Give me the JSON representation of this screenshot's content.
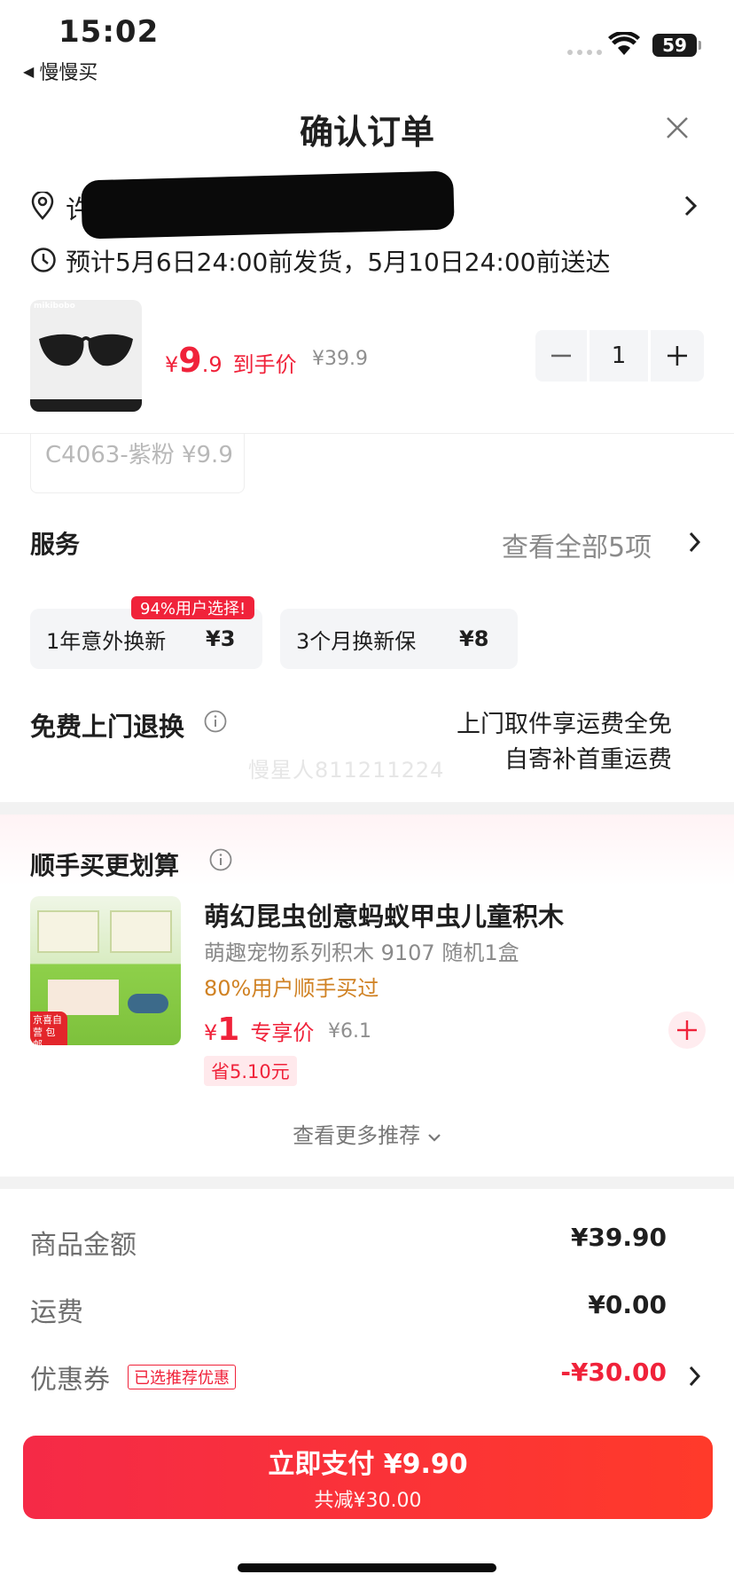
{
  "status_bar": {
    "time": "15:02",
    "back_app": "慢慢买",
    "battery": "59"
  },
  "header": {
    "title": "确认订单"
  },
  "address": {
    "visible_prefix": "许",
    "delivery": "预计5月6日24:00前发货，5月10日24:00前送达"
  },
  "product": {
    "brand": "mikibobo",
    "price_yen": "¥",
    "price_int": "9",
    "price_dec": ".9",
    "price_label": "到手价",
    "original_price": "¥39.9",
    "quantity": "1",
    "variant": "C4063-紫粉 ¥9.9"
  },
  "services": {
    "title": "服务",
    "view_all": "查看全部5项",
    "options": [
      {
        "name": "1年意外换新",
        "price": "¥3",
        "badge": "94%用户选择!"
      },
      {
        "name": "3个月换新保",
        "price": "¥8"
      }
    ],
    "return_title": "免费上门退换",
    "return_line1": "上门取件享运费全免",
    "return_line2": "自寄补首重运费",
    "watermark": "慢星人811211224"
  },
  "recommend": {
    "title": "顺手买更划算",
    "name": "萌幻昆虫创意蚂蚁甲虫儿童积木",
    "sub": "萌趣宠物系列积木 9107 随机1盒",
    "social": "80%用户顺手买过",
    "price_yen": "¥",
    "price": "1",
    "price_label": "专享价",
    "original_price": "¥6.1",
    "save": "省5.10元",
    "image_tag": "京喜自营 包邮",
    "more": "查看更多推荐"
  },
  "summary": {
    "goods_label": "商品金额",
    "goods_value": "¥39.90",
    "shipping_label": "运费",
    "shipping_value": "¥0.00",
    "coupon_label": "优惠券",
    "coupon_tag": "已选推荐优惠",
    "coupon_value": "-¥30.00"
  },
  "pay": {
    "main": "立即支付 ¥9.90",
    "sub": "共减¥30.00"
  },
  "colors": {
    "accent": "#f0223a",
    "social": "#d08224",
    "muted": "#8a8a8a"
  }
}
